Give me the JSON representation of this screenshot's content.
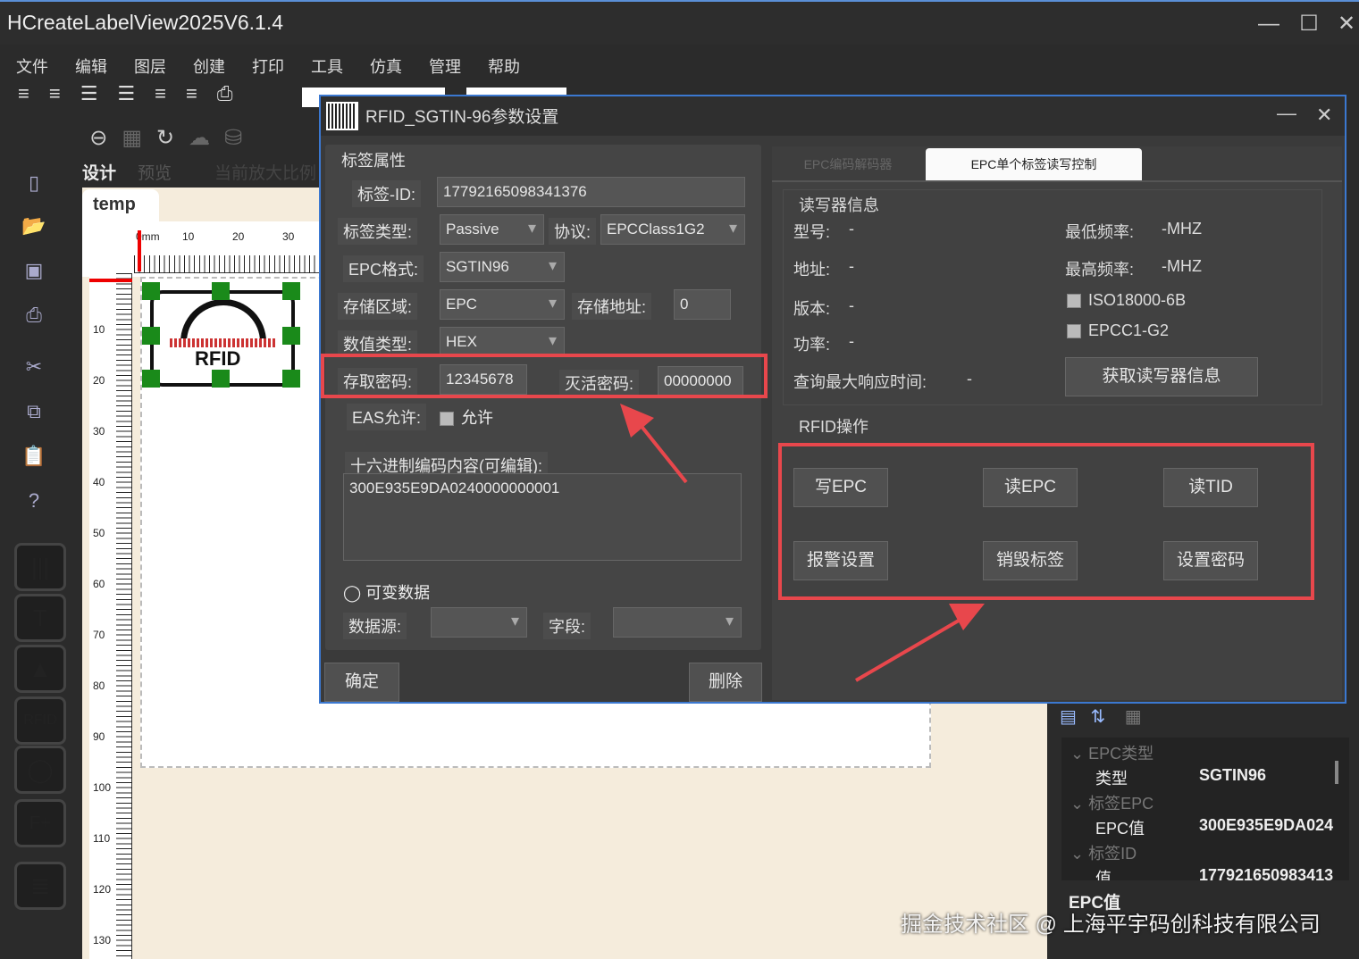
{
  "app": {
    "title": "HCreateLabelView2025V6.1.4"
  },
  "menu": [
    "文件",
    "编辑",
    "图层",
    "创建",
    "打印",
    "工具",
    "仿真",
    "管理",
    "帮助"
  ],
  "design_tabs": {
    "design": "设计",
    "preview": "预览",
    "zoom": "当前放大比例"
  },
  "doc_tab": "temp",
  "ruler": {
    "h_ticks": [
      "0mm",
      "10",
      "20",
      "30"
    ],
    "v_ticks": [
      "10",
      "20",
      "30",
      "40",
      "50",
      "60",
      "70",
      "80",
      "90",
      "100",
      "110",
      "120",
      "130"
    ]
  },
  "label_preview": {
    "rfid_text": "RFID"
  },
  "dialog": {
    "title": "RFID_SGTIN-96参数设置",
    "group_title": "标签属性",
    "tag_id_label": "标签-ID:",
    "tag_id_value": "17792165098341376",
    "tag_type_label": "标签类型:",
    "tag_type_value": "Passive",
    "protocol_label": "协议:",
    "protocol_value": "EPCClass1G2",
    "epc_format_label": "EPC格式:",
    "epc_format_value": "SGTIN96",
    "storage_area_label": "存储区域:",
    "storage_area_value": "EPC",
    "storage_addr_label": "存储地址:",
    "storage_addr_value": "0",
    "value_type_label": "数值类型:",
    "value_type_value": "HEX",
    "access_pwd_label": "存取密码:",
    "access_pwd_value": "12345678",
    "kill_pwd_label": "灭活密码:",
    "kill_pwd_value": "00000000",
    "eas_label": "EAS允许:",
    "eas_check_label": "允许",
    "hex_label": "十六进制编码内容(可编辑):",
    "hex_value": "300E935E9DA0240000000001",
    "variable_label": "可变数据",
    "datasource_label": "数据源:",
    "field_label": "字段:",
    "ok_button": "确定",
    "delete_button": "删除",
    "tabs": [
      "EPC编码解码器",
      "EPC单个标签读写控制"
    ],
    "reader_info_title": "读写器信息",
    "model_label": "型号:",
    "model_value": "-",
    "addr_label": "地址:",
    "addr_value": "-",
    "version_label": "版本:",
    "version_value": "-",
    "power_label": "功率:",
    "power_value": "-",
    "max_resp_label": "查询最大响应时间:",
    "max_resp_value": "-",
    "min_freq_label": "最低频率:",
    "min_freq_value": "-MHZ",
    "max_freq_label": "最高频率:",
    "max_freq_value": "-MHZ",
    "iso_label": "ISO18000-6B",
    "epc_c1g2_label": "EPCC1-G2",
    "get_reader_info_button": "获取读写器信息",
    "rfid_ops_title": "RFID操作",
    "ops": [
      "写EPC",
      "读EPC",
      "读TID",
      "报警设置",
      "销毁标签",
      "设置密码"
    ]
  },
  "properties": {
    "groups": [
      {
        "title": "EPC类型",
        "key": "类型",
        "value": "SGTIN96"
      },
      {
        "title": "标签EPC",
        "key": "EPC值",
        "value": "300E935E9DA024"
      },
      {
        "title": "标签ID",
        "key": "值",
        "value": "177921650983413"
      }
    ],
    "footer": "EPC值"
  },
  "watermark": "掘金技术社区 @ 上海平宇码创科技有限公司",
  "colors": {
    "accent": "#3b78d0",
    "highlight": "#e8474c",
    "handle": "#1a8a1a"
  }
}
